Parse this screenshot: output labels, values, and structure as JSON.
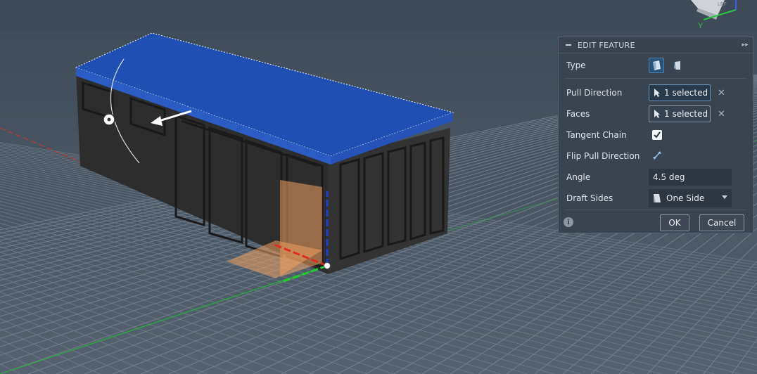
{
  "panel": {
    "title": "EDIT FEATURE",
    "type_label": "Type",
    "pull_direction_label": "Pull Direction",
    "pull_direction_value": "1 selected",
    "faces_label": "Faces",
    "faces_value": "1 selected",
    "tangent_chain_label": "Tangent Chain",
    "tangent_chain_checked": true,
    "flip_pull_direction_label": "Flip Pull Direction",
    "angle_label": "Angle",
    "angle_value": "4.5 deg",
    "draft_sides_label": "Draft Sides",
    "draft_sides_value": "One Side",
    "ok_label": "OK",
    "cancel_label": "Cancel"
  },
  "viewcube": {
    "axis_y_label": "Y",
    "face_text": "LEF"
  },
  "colors": {
    "background": "#485562",
    "roof": "#1f4fb3",
    "body": "#2e2e2e",
    "grid": "#7e8a96",
    "x_axis": "#c0392b",
    "y_axis": "#27ae3a",
    "z_axis": "#1a3ccf",
    "draft_plane": "#f0a060",
    "panel_bg": "#3a4350",
    "selection_border": "#6c93b8"
  },
  "icons": {
    "draft_type_one": "draft-fixed-plane-icon",
    "draft_type_two": "draft-parting-line-icon",
    "cursor": "select-cursor-icon",
    "flip": "flip-arrows-icon",
    "draft_sides": "draft-sides-icon",
    "info": "info-icon"
  }
}
